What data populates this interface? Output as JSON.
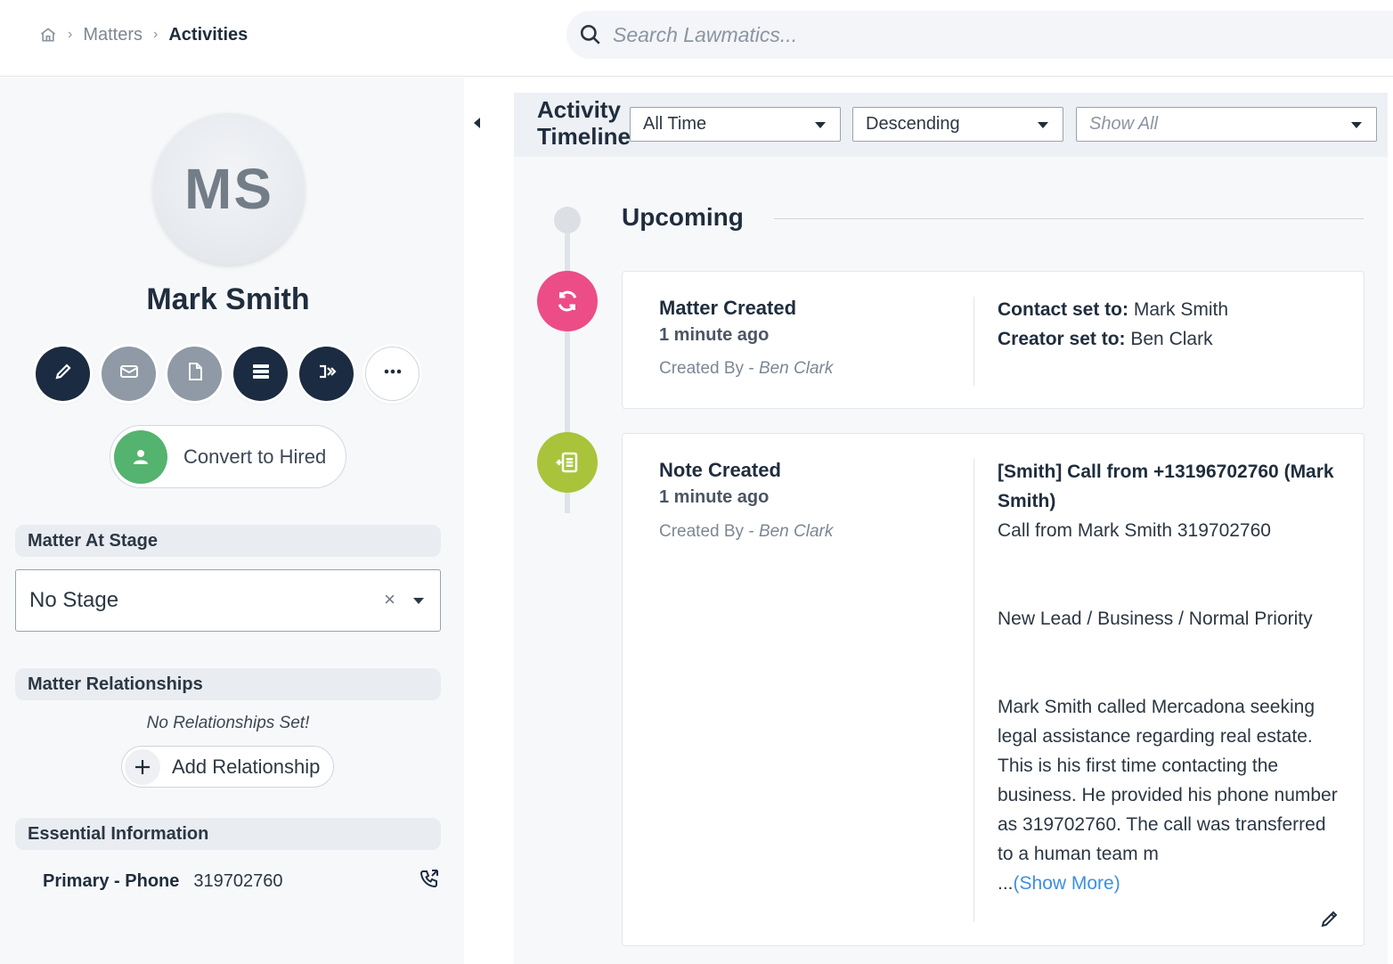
{
  "breadcrumb": {
    "items": [
      "Matters",
      "Activities"
    ]
  },
  "search": {
    "placeholder": "Search Lawmatics..."
  },
  "contact": {
    "initials": "MS",
    "name": "Mark Smith"
  },
  "actions": [
    "edit-icon",
    "mail-icon",
    "document-icon",
    "list-icon",
    "sequence-icon",
    "more-icon"
  ],
  "convert": {
    "label": "Convert to Hired"
  },
  "stage": {
    "header": "Matter At Stage",
    "value": "No Stage"
  },
  "relationships": {
    "header": "Matter Relationships",
    "empty": "No Relationships Set!",
    "add_label": "Add Relationship"
  },
  "essential": {
    "header": "Essential Information",
    "phone_label": "Primary - Phone",
    "phone_value": "319702760"
  },
  "timeline": {
    "title_line1": "Activity",
    "title_line2": "Timeline",
    "filters": {
      "time": "All Time",
      "order": "Descending",
      "show_placeholder": "Show All"
    },
    "section": "Upcoming",
    "events": [
      {
        "title": "Matter Created",
        "ago": "1 minute ago",
        "by_prefix": "Created By - ",
        "by": "Ben Clark",
        "details": [
          {
            "label": "Contact set to:",
            "value": "Mark Smith"
          },
          {
            "label": "Creator set to:",
            "value": "Ben Clark"
          }
        ]
      },
      {
        "title": "Note Created",
        "ago": "1 minute ago",
        "by_prefix": "Created By - ",
        "by": "Ben Clark",
        "note_title": "[Smith] Call from +13196702760 (Mark Smith)",
        "note_sub": "Call from Mark Smith 319702760",
        "note_tags": "New Lead / Business / Normal Priority",
        "note_body": "Mark Smith called Mercadona seeking legal assistance regarding real estate. This is his first time contacting the business. He provided his phone number as 319702760. The call was transferred to a human team m",
        "note_ellipsis": "...",
        "show_more": "(Show More)"
      }
    ]
  },
  "colors": {
    "dark_navy": "#1b2b41",
    "pink": "#ec4d86",
    "olive": "#a9c43a",
    "green": "#54b36e",
    "link": "#3d8fe0"
  }
}
